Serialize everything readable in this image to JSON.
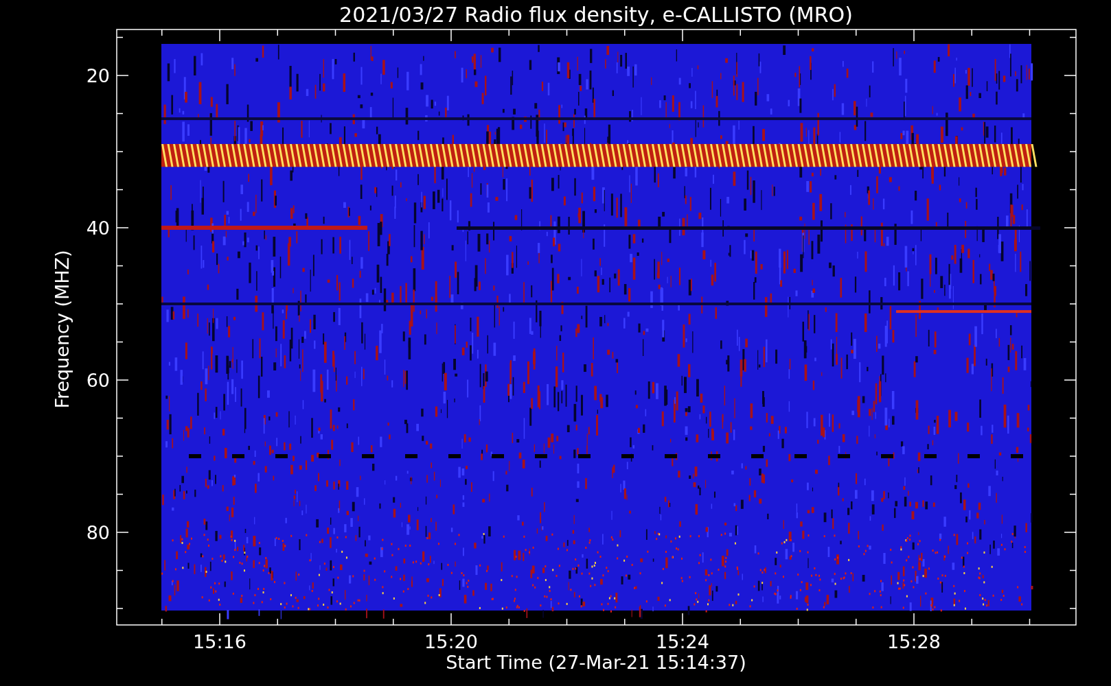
{
  "title": "2021/03/27  Radio flux density, e-CALLISTO (MRO)",
  "y_axis": {
    "label": "Frequency (MHZ)",
    "ticks": [
      "20",
      "40",
      "60",
      "80"
    ]
  },
  "x_axis": {
    "label": "Start Time (27-Mar-21 15:14:37)",
    "ticks": [
      "15:16",
      "15:20",
      "15:24",
      "15:28"
    ]
  }
}
